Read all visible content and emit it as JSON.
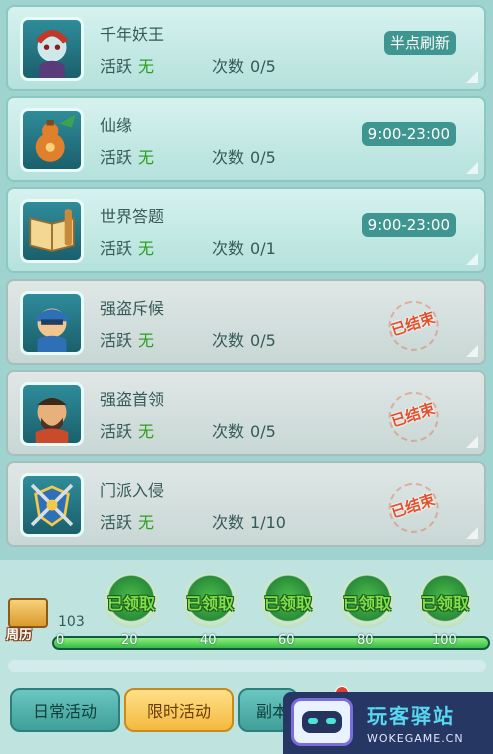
{
  "events": [
    {
      "title": "千年妖王",
      "active_label": "活跃",
      "active_value": "无",
      "count_label": "次数",
      "count_value": "0/5",
      "badge": "半点刷新",
      "ended": false,
      "icon": "demon-king-icon"
    },
    {
      "title": "仙缘",
      "active_label": "活跃",
      "active_value": "无",
      "count_label": "次数",
      "count_value": "0/5",
      "badge": "9:00-23:00",
      "ended": false,
      "icon": "fairy-gourd-icon"
    },
    {
      "title": "世界答题",
      "active_label": "活跃",
      "active_value": "无",
      "count_label": "次数",
      "count_value": "0/1",
      "badge": "9:00-23:00",
      "ended": false,
      "icon": "book-scroll-icon"
    },
    {
      "title": "强盗斥候",
      "active_label": "活跃",
      "active_value": "无",
      "count_label": "次数",
      "count_value": "0/5",
      "badge": "已结束",
      "ended": true,
      "icon": "bandit-scout-icon"
    },
    {
      "title": "强盗首领",
      "active_label": "活跃",
      "active_value": "无",
      "count_label": "次数",
      "count_value": "0/5",
      "badge": "已结束",
      "ended": true,
      "icon": "bandit-leader-icon"
    },
    {
      "title": "门派入侵",
      "active_label": "活跃",
      "active_value": "无",
      "count_label": "次数",
      "count_value": "1/10",
      "badge": "已结束",
      "ended": true,
      "icon": "crossed-swords-shield-icon"
    }
  ],
  "progress": {
    "calendar_label": "周历",
    "score": "103",
    "fraction": 1.0,
    "milestones": [
      "0",
      "20",
      "40",
      "60",
      "80",
      "100"
    ],
    "rewards": [
      {
        "label": "已领取"
      },
      {
        "label": "已领取"
      },
      {
        "label": "已领取"
      },
      {
        "label": "已领取"
      },
      {
        "label": "已领取"
      }
    ]
  },
  "tabs": {
    "daily": "日常活动",
    "timed": "限时活动",
    "dungeon": "副本"
  },
  "watermark": {
    "title": "玩客驿站",
    "url": "WOKEGAME.CN"
  },
  "colors": {
    "active_none": "#2d9e1f",
    "badge_bg": "#3f9691",
    "ended_stamp": "#e24f2a",
    "tab_selected": "#f4b93e"
  }
}
